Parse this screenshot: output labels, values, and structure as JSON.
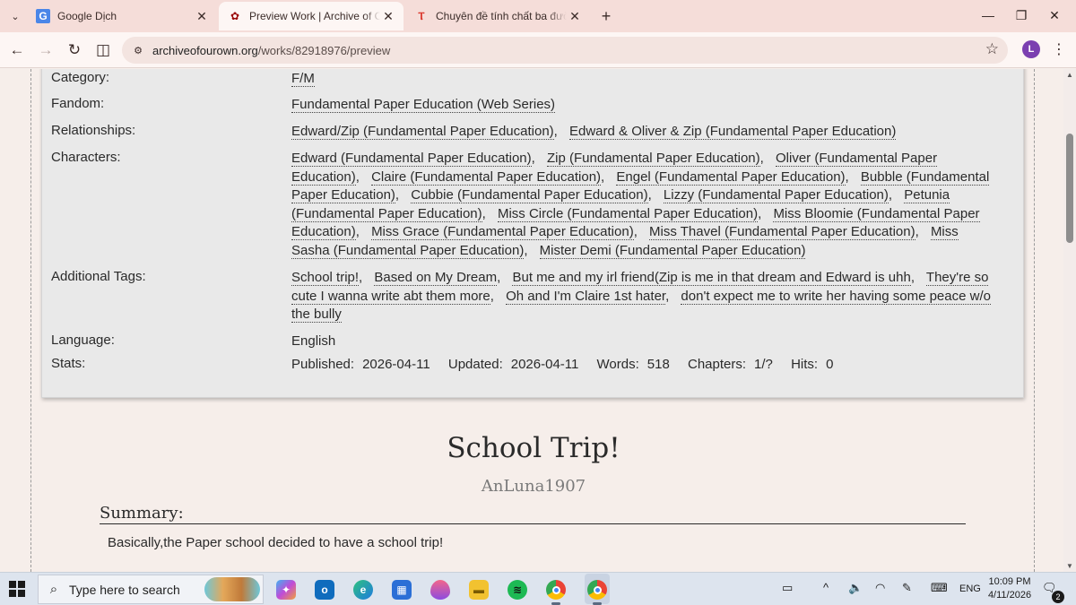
{
  "browser": {
    "tabs": [
      {
        "title": "Google Dịch",
        "icon": "google-translate-icon",
        "active": false
      },
      {
        "title": "Preview Work | Archive of Our Own",
        "icon": "ao3-icon",
        "active": true
      },
      {
        "title": "Chuyên đề tính chất ba đường",
        "icon": "vietjack-icon",
        "active": false
      }
    ],
    "url_host": "archiveofourown.org",
    "url_path": "/works/82918976/preview",
    "profile_initial": "L"
  },
  "work": {
    "meta": {
      "category_label": "Category:",
      "category": [
        "F/M"
      ],
      "fandom_label": "Fandom:",
      "fandom": [
        "Fundamental Paper Education (Web Series)"
      ],
      "relationships_label": "Relationships:",
      "relationships": [
        "Edward/Zip (Fundamental Paper Education)",
        "Edward & Oliver & Zip (Fundamental Paper Education)"
      ],
      "characters_label": "Characters:",
      "characters": [
        "Edward (Fundamental Paper Education)",
        "Zip (Fundamental Paper Education)",
        "Oliver (Fundamental Paper Education)",
        "Claire (Fundamental Paper Education)",
        "Engel (Fundamental Paper Education)",
        "Bubble (Fundamental Paper Education)",
        "Cubbie (Fundamental Paper Education)",
        "Lizzy (Fundamental Paper Education)",
        "Petunia (Fundamental Paper Education)",
        "Miss Circle (Fundamental Paper Education)",
        "Miss Bloomie (Fundamental Paper Education)",
        "Miss Grace (Fundamental Paper Education)",
        "Miss Thavel (Fundamental Paper Education)",
        "Miss Sasha (Fundamental Paper Education)",
        "Mister Demi (Fundamental Paper Education)"
      ],
      "additional_tags_label": "Additional Tags:",
      "additional_tags": [
        "School trip!",
        "Based on My Dream",
        "But me and my irl friend(Zip is me in that dream and Edward is uhh",
        "They're so cute I wanna write abt them more",
        "Oh and I'm Claire 1st hater",
        "don't expect me to write her having some peace w/o the bully"
      ],
      "language_label": "Language:",
      "language": "English",
      "stats_label": "Stats:",
      "stats": {
        "published_label": "Published:",
        "published": "2026-04-11",
        "updated_label": "Updated:",
        "updated": "2026-04-11",
        "words_label": "Words:",
        "words": "518",
        "chapters_label": "Chapters:",
        "chapters": "1/?",
        "hits_label": "Hits:",
        "hits": "0"
      }
    },
    "title": "School Trip!",
    "author": "AnLuna1907",
    "summary_heading": "Summary:",
    "summary": "Basically,the Paper school decided to have a school trip!"
  },
  "taskbar": {
    "search_placeholder": "Type here to search",
    "language": "ENG",
    "time": "10:09 PM",
    "date": "4/11/2026",
    "notification_count": "2"
  }
}
